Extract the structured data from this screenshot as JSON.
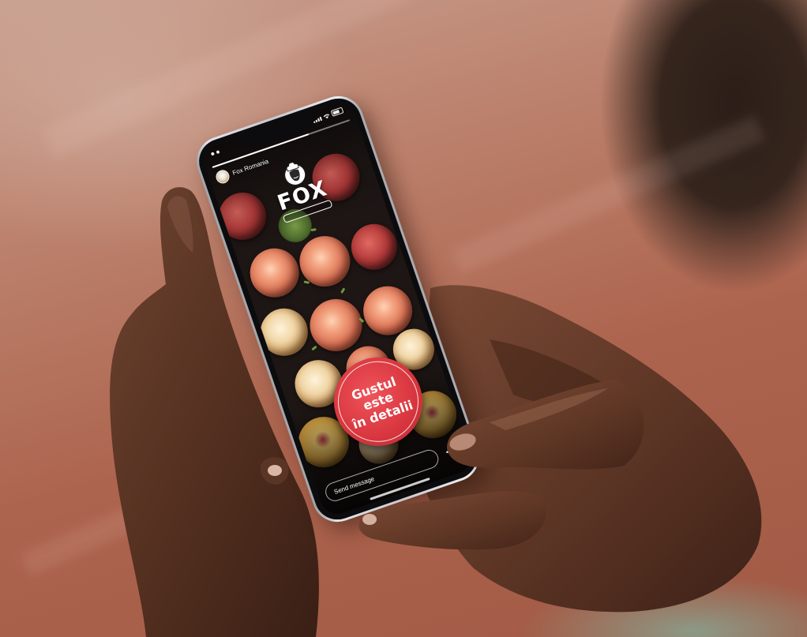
{
  "story": {
    "account_name": "Fox Romania",
    "logo_text": "FOX",
    "sticker_lines": [
      "Gustul",
      "este",
      "în detalii"
    ],
    "reply_placeholder": "Send message"
  },
  "icons": {
    "logo": "chef-logo-icon",
    "share": "paper-plane-icon",
    "status": [
      "signal-icon",
      "wifi-icon",
      "battery-icon"
    ]
  },
  "colors": {
    "sticker": "#d8363e",
    "skin": "#5a3424",
    "background": "#b06d58",
    "phone_frame": "#c7c8cc"
  }
}
